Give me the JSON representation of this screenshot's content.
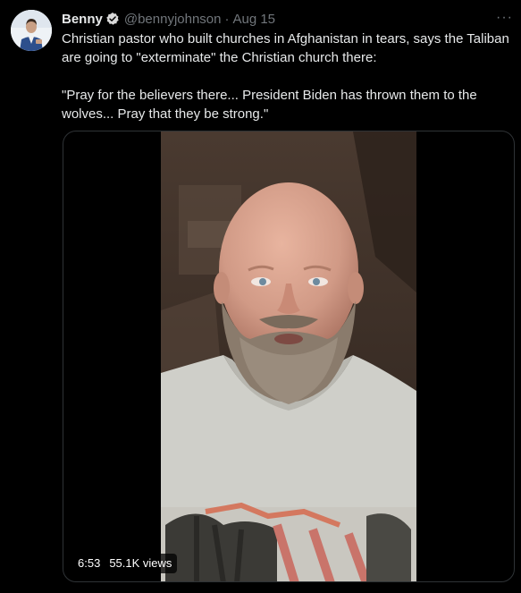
{
  "tweet": {
    "author": {
      "display_name": "Benny",
      "handle": "@bennyjohnson",
      "verified_icon": "verified-badge-icon"
    },
    "separator": "·",
    "date": "Aug 15",
    "more_icon": "more-options-icon",
    "more_glyph": "···",
    "text_line_1": "Christian pastor who built churches in Afghanistan in tears, says the Taliban are going to \"exterminate\" the Christian church there:",
    "text_line_2": "\"Pray for the believers there... President Biden has thrown them to the wolves... Pray that they be strong.\"",
    "media": {
      "duration": "6:53",
      "views": "55.1K views"
    }
  },
  "colors": {
    "background": "#000000",
    "text": "#e7e9ea",
    "muted": "#71767b",
    "verified": "#d9d9d9",
    "border": "#2f3336"
  }
}
